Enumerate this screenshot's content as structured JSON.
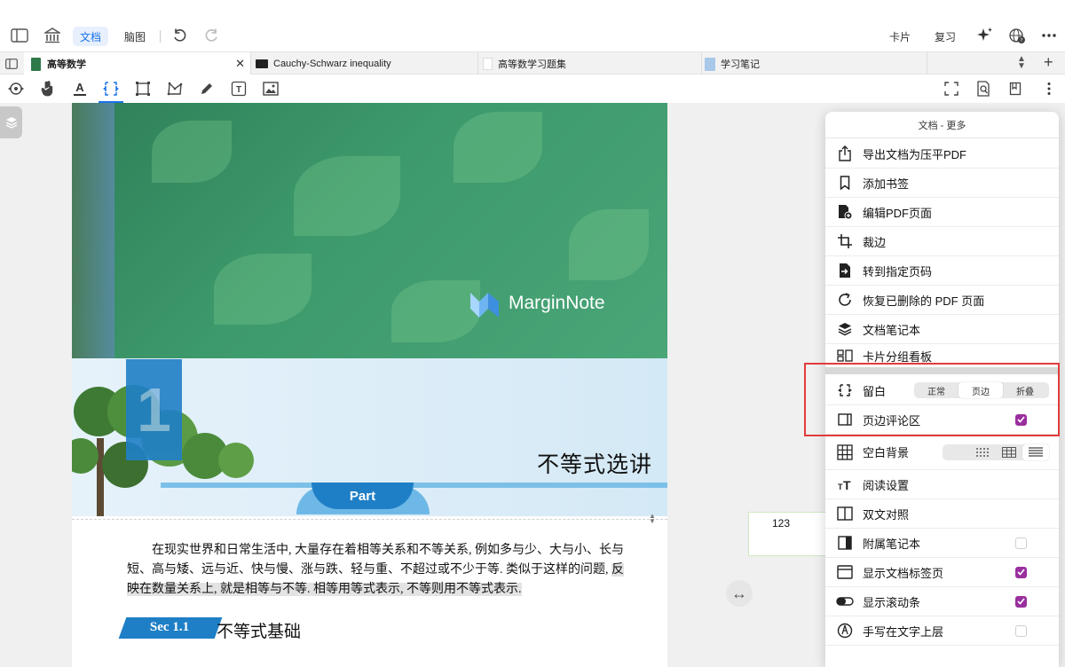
{
  "topbar": {
    "doc_tab_label": "文档",
    "mindmap_tab_label": "脑图",
    "card_label": "卡片",
    "review_label": "复习",
    "www_badge": "WWW"
  },
  "tabs": [
    {
      "label": "高等数学",
      "active": true
    },
    {
      "label": "Cauchy-Schwarz inequality",
      "active": false
    },
    {
      "label": "高等数学习题集",
      "active": false
    },
    {
      "label": "学习笔记",
      "active": false
    }
  ],
  "document": {
    "brand": "MarginNote",
    "chapter_number": "1",
    "chapter_title": "不等式选讲",
    "part_label": "Part",
    "paragraph_plain": "在现实世界和日常生活中, 大量存在着相等关系和不等关系, 例如多与少、大与小、长与短、高与矮、远与近、快与慢、涨与跌、轻与重、不超过或不少于等. 类似于这样的问题, ",
    "paragraph_highlight": "反映在数量关系上, 就是相等与不等. 相等用等式表示, 不等则用不等式表示.",
    "section_tag": "Sec 1.1",
    "section_title": "不等式基础"
  },
  "margin_note": {
    "text": "123"
  },
  "menu": {
    "title": "文档 - 更多",
    "items": [
      {
        "label": "导出文档为压平PDF",
        "icon": "share-icon"
      },
      {
        "label": "添加书签",
        "icon": "bookmark-icon"
      },
      {
        "label": "编辑PDF页面",
        "icon": "edit-pdf-icon"
      },
      {
        "label": "裁边",
        "icon": "crop-icon"
      },
      {
        "label": "转到指定页码",
        "icon": "goto-page-icon"
      },
      {
        "label": "恢复已删除的 PDF 页面",
        "icon": "restore-icon"
      },
      {
        "label": "文档笔记本",
        "icon": "layers-icon"
      },
      {
        "label": "卡片分组看板",
        "icon": "board-icon"
      }
    ],
    "margin": {
      "label": "留白",
      "options": [
        "正常",
        "页边",
        "折叠"
      ],
      "selected": "页边"
    },
    "margin_comments": {
      "label": "页边评论区",
      "checked": true
    },
    "blank_bg": {
      "label": "空白背景"
    },
    "reading_settings": {
      "label": "阅读设置"
    },
    "bilingual": {
      "label": "双文对照"
    },
    "attached_notebook": {
      "label": "附属笔记本",
      "checked": false
    },
    "show_doc_tabs": {
      "label": "显示文档标签页",
      "checked": true
    },
    "show_scrollbar": {
      "label": "显示滚动条",
      "checked": true
    },
    "handwriting_above_text": {
      "label": "手写在文字上层",
      "checked": false
    }
  },
  "colors": {
    "accent_blue": "#1a73e8",
    "check_purple": "#9a2f9e",
    "highlight_red": "#e23b3b",
    "hero_green": "#3d9a6c",
    "part_blue": "#1f7fc6"
  }
}
